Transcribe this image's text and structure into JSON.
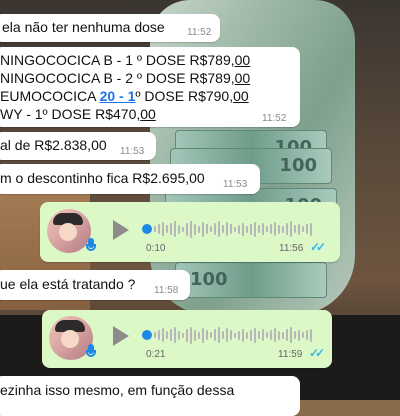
{
  "messages": [
    {
      "text": "ela não ter nenhuma dose",
      "time": "11:52"
    },
    {
      "lines": [
        {
          "pre": "NINGOCOCICA B - 1 º DOSE R$789,",
          "u": "00"
        },
        {
          "pre": "NINGOCOCICA B - 2 º DOSE R$789,",
          "u": "00"
        },
        {
          "pre": "EUMOCOCICA ",
          "link": "20 - 1",
          "mid": "º DOSE R$790,",
          "u": "00"
        },
        {
          "pre": "WY - 1º DOSE R$470,",
          "u": "00"
        }
      ],
      "time": "11:52"
    },
    {
      "text": "al de R$2.838,00",
      "time": "11:53"
    },
    {
      "text": "m o descontinho fica R$2.695,00",
      "time": "11:53"
    },
    {
      "text": "ue ela está tratando ?",
      "time": "11:58"
    },
    {
      "text": "ezinha isso mesmo,  em função dessa",
      "time": ""
    }
  ],
  "voice_notes": [
    {
      "duration": "0:10",
      "time": "11:56",
      "status": "read"
    },
    {
      "duration": "0:21",
      "time": "11:59",
      "status": "read"
    }
  ],
  "background_notes": [
    "100",
    "100",
    "100",
    "100"
  ],
  "colors": {
    "outgoing": "#dcf8c6",
    "incoming": "#ffffff",
    "accent": "#1e88e5",
    "read_ticks": "#34b7f1"
  }
}
